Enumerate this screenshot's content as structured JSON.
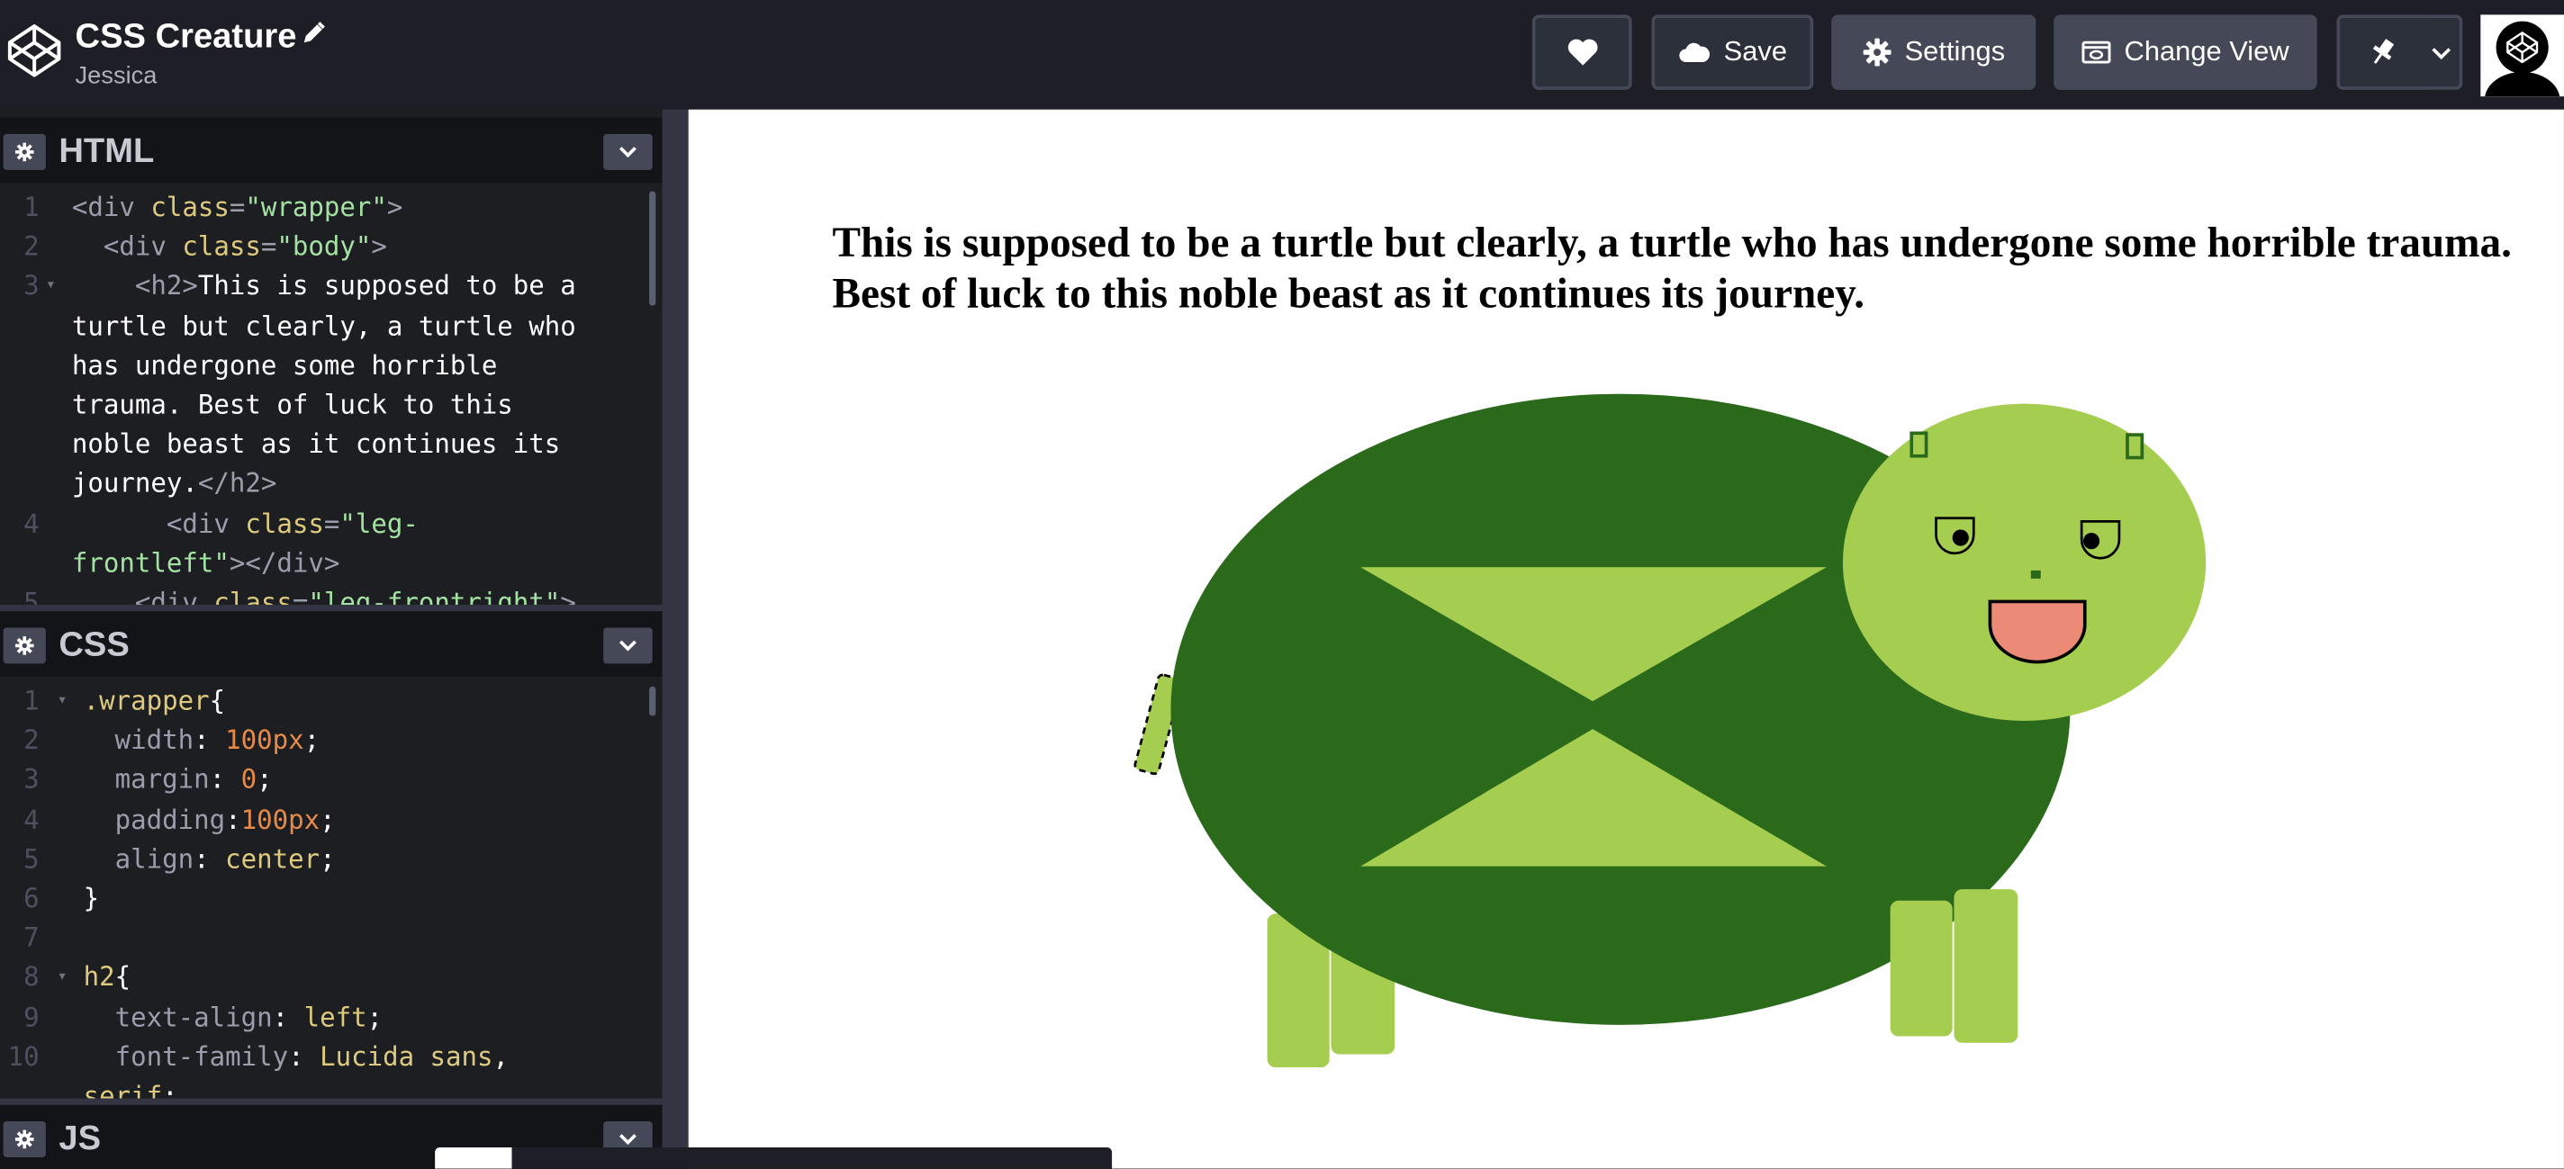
{
  "header": {
    "title": "CSS Creature",
    "author": "Jessica",
    "buttons": {
      "save": "Save",
      "settings": "Settings",
      "change_view": "Change View"
    }
  },
  "panels": {
    "html": {
      "name": "HTML",
      "line_numbers": [
        "1",
        "2",
        "3",
        "",
        "",
        "",
        "",
        "",
        "4",
        "",
        "5"
      ],
      "lines": [
        "<div class=\"wrapper\">",
        "  <div class=\"body\">",
        "    <h2>This is supposed to be a",
        "turtle but clearly, a turtle who",
        "has undergone some horrible",
        "trauma. Best of luck to this",
        "noble beast as it continues its",
        "journey.</h2>",
        "      <div class=\"leg-",
        "frontleft\"></div>",
        "    <div class=\"leg-frontright\">"
      ]
    },
    "css": {
      "name": "CSS",
      "line_numbers": [
        "1",
        "2",
        "3",
        "4",
        "5",
        "6",
        "7",
        "8",
        "9",
        "10",
        ""
      ],
      "lines": [
        ".wrapper{",
        "  width: 100px;",
        "  margin: 0;",
        "  padding:100px;",
        "  align: center;",
        "}",
        "",
        "h2{",
        "  text-align: left;",
        "  font-family: Lucida sans,",
        "serif;"
      ]
    },
    "js": {
      "name": "JS"
    }
  },
  "preview": {
    "heading": "This is supposed to be a turtle but clearly, a turtle who has undergone some horrible trauma. Best of luck to this noble beast as it continues its journey."
  },
  "colors": {
    "shell": "#2a6a1a",
    "light_green": "#a5cd50",
    "tongue": "#ec8a78",
    "header_bg": "#1e1f26",
    "button_bg": "#444857"
  }
}
